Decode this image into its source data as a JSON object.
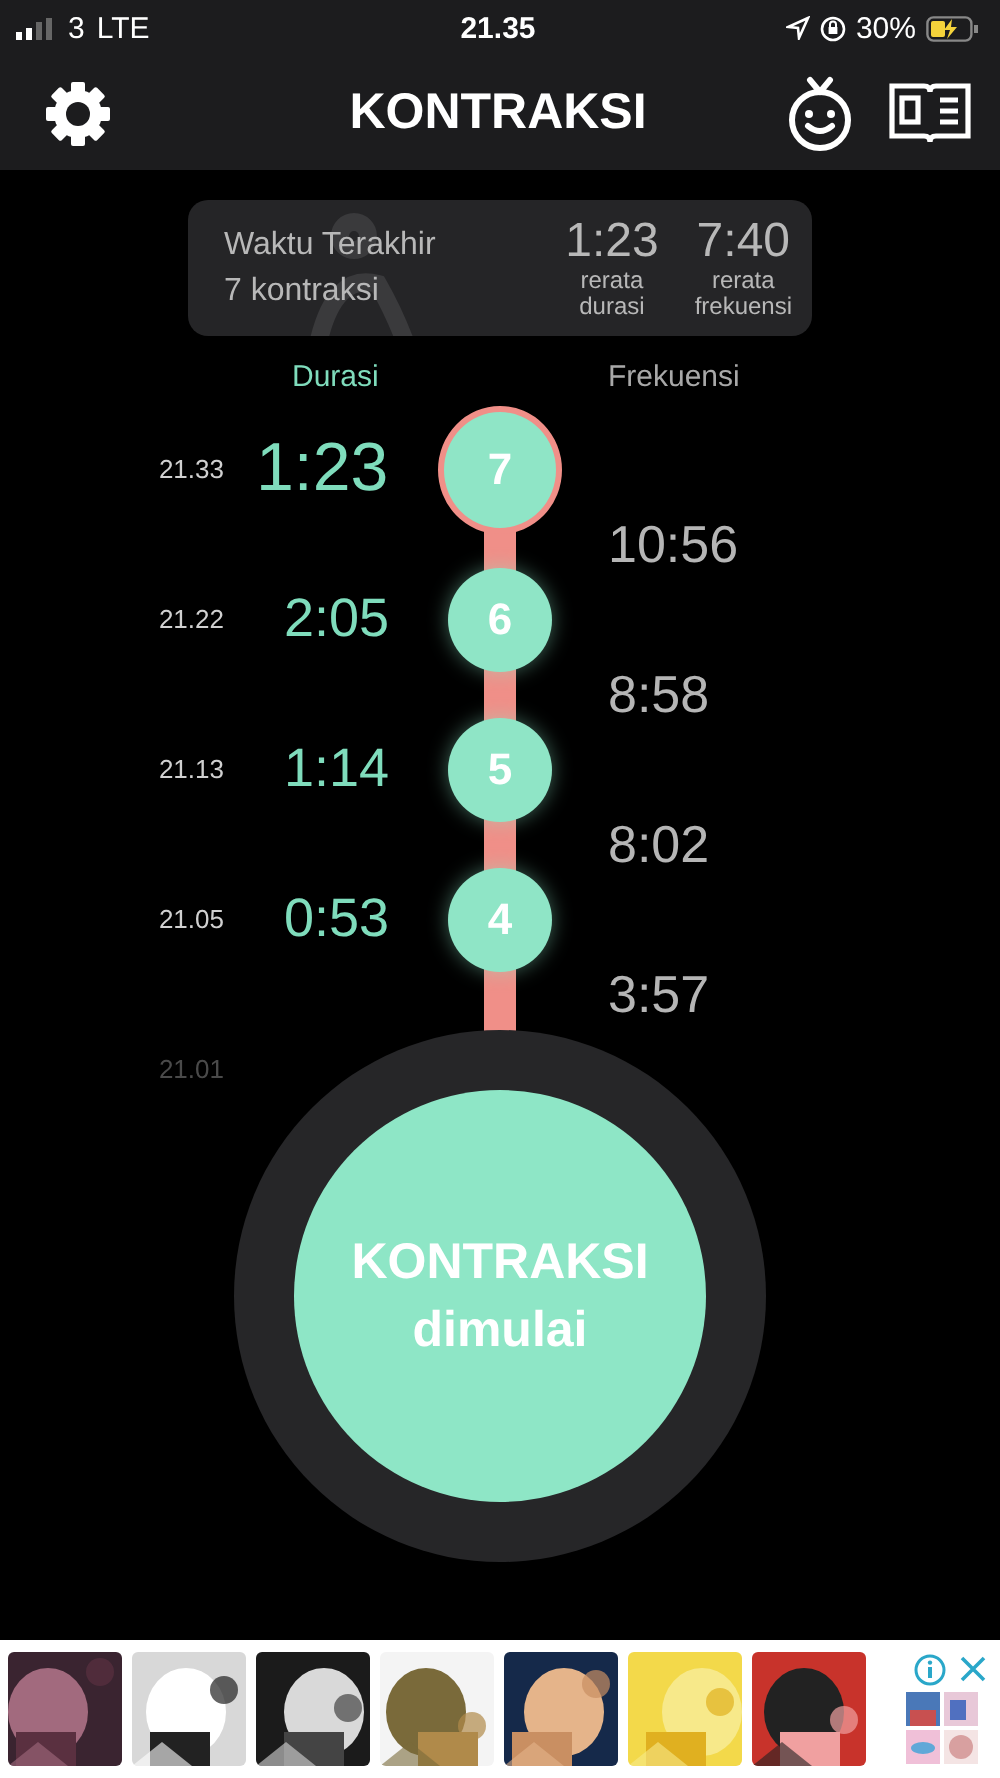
{
  "status_bar": {
    "carrier": "3",
    "network": "LTE",
    "time": "21.35",
    "battery": "30%"
  },
  "header": {
    "title": "KONTRAKSI"
  },
  "summary": {
    "label": "Waktu Terakhir",
    "count": "7 kontraksi",
    "stats": [
      {
        "value": "1:23",
        "label": "rerata durasi"
      },
      {
        "value": "7:40",
        "label": "rerata frekuensi"
      }
    ]
  },
  "columns": {
    "duration": "Durasi",
    "frequency": "Frekuensi"
  },
  "contractions": [
    {
      "time": "21.33",
      "duration": "1:23",
      "number": "7",
      "selected": true
    },
    {
      "time": "21.22",
      "duration": "2:05",
      "number": "6",
      "selected": false
    },
    {
      "time": "21.13",
      "duration": "1:14",
      "number": "5",
      "selected": false
    },
    {
      "time": "21.05",
      "duration": "0:53",
      "number": "4",
      "selected": false
    },
    {
      "time": "21.01"
    }
  ],
  "frequencies": [
    "10:56",
    "8:58",
    "8:02",
    "3:57"
  ],
  "start_button": {
    "lines": [
      "KONTRAKSI",
      "dimulai"
    ]
  },
  "ad_banner": {
    "images": [
      {
        "kind": "picture"
      },
      {
        "kind": "picture"
      },
      {
        "kind": "picture"
      },
      {
        "kind": "picture"
      },
      {
        "kind": "picture"
      },
      {
        "kind": "picture"
      },
      {
        "kind": "picture"
      }
    ],
    "thumbnail": {
      "kind": "picture"
    }
  }
}
